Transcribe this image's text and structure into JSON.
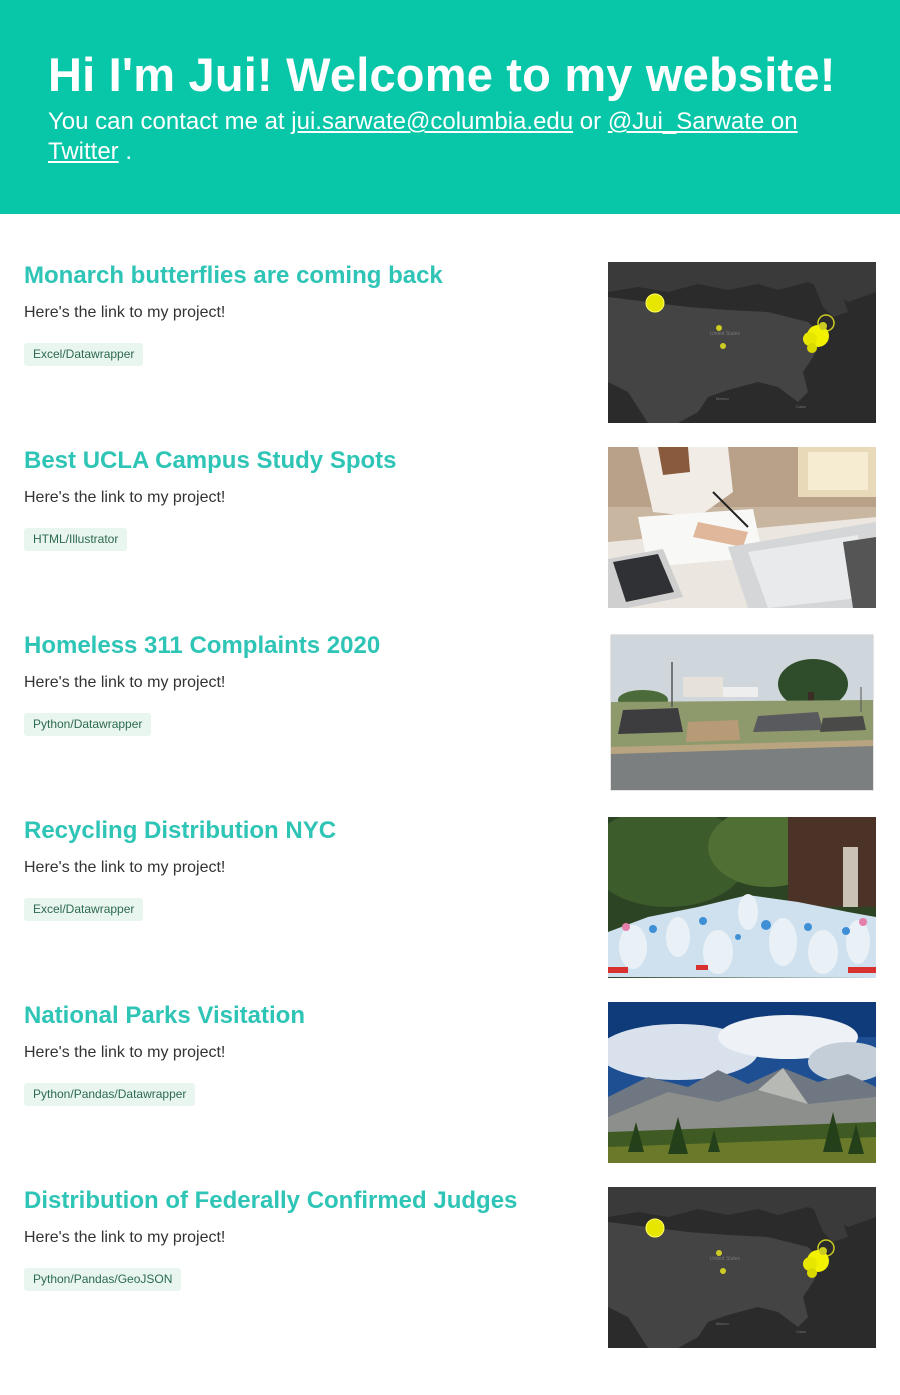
{
  "header": {
    "title": "Hi I'm Jui! Welcome to my website!",
    "contact_prefix": "You can contact me at ",
    "email": "jui.sarwate@columbia.edu",
    "contact_or": " or ",
    "twitter": "@Jui_Sarwate on Twitter",
    "contact_suffix": " ."
  },
  "projects": [
    {
      "title": "Monarch butterflies are coming back",
      "desc": "Here's the link to my project!",
      "tag": "Excel/Datawrapper",
      "image": "dark-map"
    },
    {
      "title": "Best UCLA Campus Study Spots",
      "desc": "Here's the link to my project!",
      "tag": "HTML/Illustrator",
      "image": "study-desk-photo"
    },
    {
      "title": "Homeless 311 Complaints 2020",
      "desc": "Here's the link to my project!",
      "tag": "Python/Datawrapper",
      "image": "encampment-photo"
    },
    {
      "title": "Recycling Distribution NYC",
      "desc": "Here's the link to my project!",
      "tag": "Excel/Datawrapper",
      "image": "plastic-bottles-photo"
    },
    {
      "title": "National Parks Visitation",
      "desc": "Here's the link to my project!",
      "tag": "Python/Pandas/Datawrapper",
      "image": "mountain-landscape-photo"
    },
    {
      "title": "Distribution of Federally Confirmed Judges",
      "desc": "Here's the link to my project!",
      "tag": "Python/Pandas/GeoJSON",
      "image": "dark-map"
    }
  ],
  "colors": {
    "header_bg": "#08c6a8",
    "project_title": "#2ec4b6",
    "tag_bg": "#e8f6ef",
    "tag_text": "#2d6a4f"
  }
}
